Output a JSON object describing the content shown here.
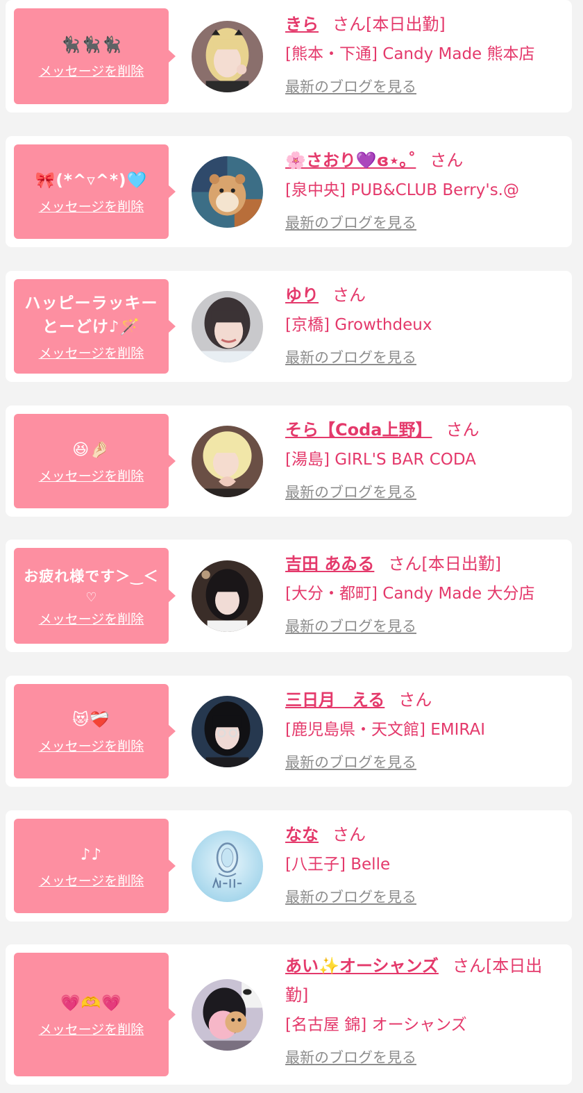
{
  "delete_label": "メッセージを削除",
  "san_label": "さん",
  "blog_label": "最新のブログを見る",
  "colors": {
    "bubble": "#fd8fa1",
    "accent": "#e4396b",
    "blog_link": "#8d8d8d",
    "background": "#f3f3f3"
  },
  "cards": [
    {
      "message": "🐈‍⬛🐈‍⬛🐈‍⬛",
      "message_extra": "",
      "name": "きら",
      "status": "[本日出勤]",
      "shop": "[熊本・下通] Candy Made 熊本店",
      "avatar_icon": "blonde-girl-photo"
    },
    {
      "message": "🎀(*^▿^*)🩵",
      "message_extra": "",
      "name": "🌸さおり💜ɞ⋆｡˚",
      "status": "",
      "shop": "[泉中央] PUB&CLUB Berry's.@",
      "avatar_icon": "hamster-plush-photo"
    },
    {
      "message": "ハッピーラッキーとーどけ♪🪄",
      "message_extra": "",
      "name": "ゆり",
      "status": "",
      "shop": "[京橋] Growthdeux",
      "avatar_icon": "girl-selfie-photo"
    },
    {
      "message": "😆🤌🏻",
      "message_extra": "",
      "name": "そら【Coda上野】",
      "status": "",
      "shop": "[湯島] GIRL'S BAR CODA",
      "avatar_icon": "blonde-heart-hands-photo"
    },
    {
      "message": "お疲れ様です＞‿＜",
      "message_extra": "♡",
      "name": "吉田 あゐる",
      "status": "[本日出勤]",
      "shop": "[大分・都町] Candy Made 大分店",
      "avatar_icon": "dark-hair-girl-photo"
    },
    {
      "message": "😻❤️‍🩹",
      "message_extra": "",
      "name": "三日月　える",
      "status": "",
      "shop": "[鹿児島県・天文館] EMIRAI",
      "avatar_icon": "black-hair-glasses-photo"
    },
    {
      "message": "♪♪",
      "message_extra": "",
      "name": "なな",
      "status": "",
      "shop": "[八王子] Belle",
      "avatar_icon": "belle-logo"
    },
    {
      "message": "💗🫶💗",
      "message_extra": "",
      "name": "あい✨オーシャンズ",
      "status": "[本日出勤]",
      "shop": "[名古屋 錦] オーシャンズ",
      "avatar_icon": "girl-with-sticker-photo"
    }
  ]
}
